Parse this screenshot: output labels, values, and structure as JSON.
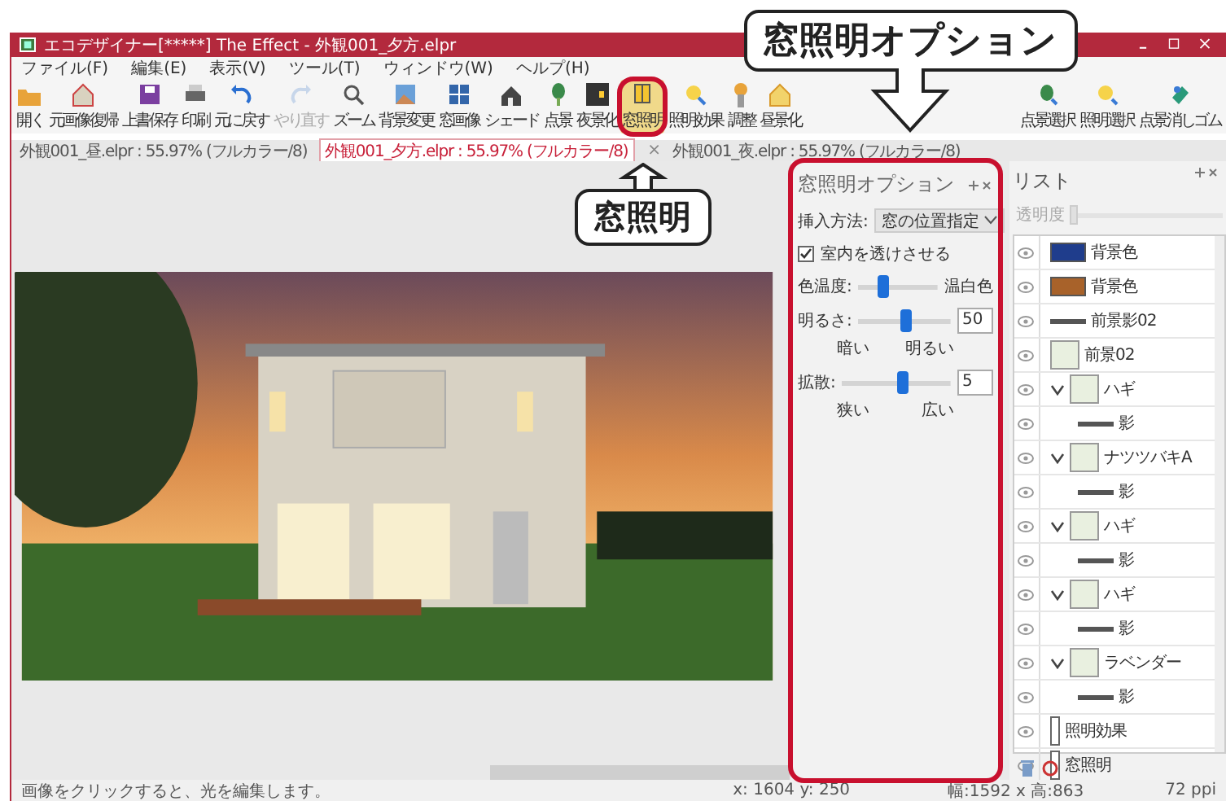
{
  "window": {
    "title": "エコデザイナー[*****] The Effect - 外観001_夕方.elpr"
  },
  "menu": [
    "ファイル(F)",
    "編集(E)",
    "表示(V)",
    "ツール(T)",
    "ウィンドウ(W)",
    "ヘルプ(H)"
  ],
  "toolbar": [
    {
      "label": "開く",
      "disabled": false,
      "selected": false
    },
    {
      "label": "元画像復帰",
      "disabled": false,
      "selected": false
    },
    {
      "label": "上書保存",
      "disabled": false,
      "selected": false
    },
    {
      "label": "印刷",
      "disabled": false,
      "selected": false
    },
    {
      "label": "元に戻す",
      "disabled": false,
      "selected": false
    },
    {
      "label": "やり直す",
      "disabled": true,
      "selected": false
    },
    {
      "label": "ズーム",
      "disabled": false,
      "selected": false
    },
    {
      "label": "背景変更",
      "disabled": false,
      "selected": false
    },
    {
      "label": "窓画像",
      "disabled": false,
      "selected": false
    },
    {
      "label": "シェード",
      "disabled": false,
      "selected": false
    },
    {
      "label": "点景",
      "disabled": false,
      "selected": false
    },
    {
      "label": "夜景化",
      "disabled": false,
      "selected": false
    },
    {
      "label": "窓照明",
      "disabled": false,
      "selected": true
    },
    {
      "label": "照明効果",
      "disabled": false,
      "selected": false
    },
    {
      "label": "調整",
      "disabled": false,
      "selected": false
    },
    {
      "label": "昼景化",
      "disabled": false,
      "selected": false
    },
    {
      "label": "点景選択",
      "disabled": false,
      "selected": false
    },
    {
      "label": "照明選択",
      "disabled": false,
      "selected": false
    },
    {
      "label": "点景消しゴム",
      "disabled": false,
      "selected": false
    }
  ],
  "doc_tabs": [
    {
      "label": "外観001_昼.elpr : 55.97% (フルカラー/8)",
      "selected": false
    },
    {
      "label": "外観001_夕方.elpr : 55.97% (フルカラー/8)",
      "selected": true,
      "close": "×"
    },
    {
      "label": "外観001_夜.elpr : 55.97% (フルカラー/8)",
      "selected": false
    }
  ],
  "options_panel": {
    "title": "窓照明オプション",
    "insert_method": {
      "label": "挿入方法:",
      "value": "窓の位置指定"
    },
    "see_through": {
      "label": "室内を透けさせる",
      "checked": true
    },
    "sliders": [
      {
        "label": "色温度:",
        "level": 0.3,
        "max_label": "温白色"
      },
      {
        "label": "明るさ:",
        "level": 0.5,
        "value": "50",
        "min_label": "暗い",
        "max_label": "明るい"
      },
      {
        "label": "拡散:",
        "level": 0.55,
        "value": "5",
        "min_label": "狭い",
        "max_label": "広い"
      }
    ]
  },
  "list_panel": {
    "title": "リスト",
    "opacity": {
      "label": "透明度",
      "disabled": true
    },
    "items": [
      {
        "label": "背景色",
        "kind": "swatch",
        "color": "#1f3d8c"
      },
      {
        "label": "背景色",
        "kind": "swatch",
        "color": "#a8622a"
      },
      {
        "label": "前景影02",
        "kind": "line"
      },
      {
        "label": "前景02",
        "kind": "image"
      },
      {
        "label": "ハギ",
        "kind": "image",
        "expanded": true,
        "children": [
          {
            "label": "影",
            "kind": "line"
          }
        ]
      },
      {
        "label": "ナツツバキA",
        "kind": "image",
        "expanded": true,
        "children": [
          {
            "label": "影",
            "kind": "line"
          }
        ]
      },
      {
        "label": "ハギ",
        "kind": "image",
        "expanded": true,
        "children": [
          {
            "label": "影",
            "kind": "line"
          }
        ]
      },
      {
        "label": "ハギ",
        "kind": "image",
        "expanded": true,
        "children": [
          {
            "label": "影",
            "kind": "line"
          }
        ]
      },
      {
        "label": "ラベンダー",
        "kind": "image",
        "expanded": true,
        "children": [
          {
            "label": "影",
            "kind": "line"
          }
        ]
      },
      {
        "label": "照明効果",
        "kind": "frame"
      },
      {
        "label": "窓照明",
        "kind": "frame"
      }
    ]
  },
  "status_bar": {
    "message": "画像をクリックすると、光を編集します。",
    "position": "x: 1604 y: 250",
    "size": "幅:1592 x 高:863",
    "resolution": "72 ppi"
  },
  "callouts": [
    {
      "text": "窓照明オプション",
      "kind": "down"
    },
    {
      "text": "窓照明",
      "kind": "up"
    }
  ]
}
